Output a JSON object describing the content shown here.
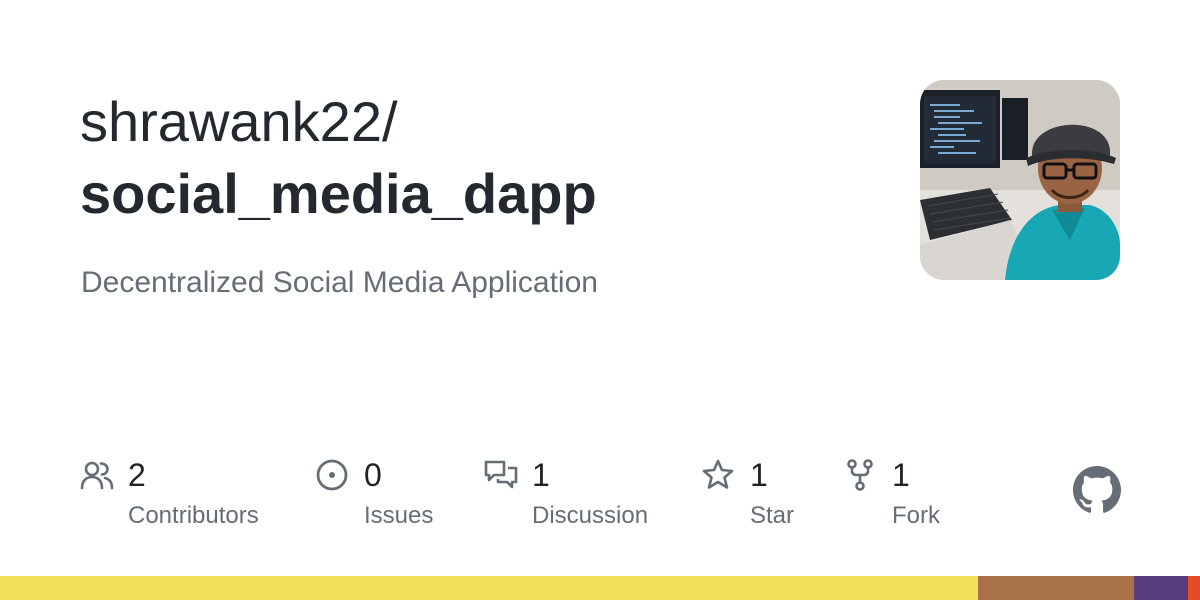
{
  "repo": {
    "owner": "shrawank22/",
    "name": "social_media_dapp",
    "description": "Decentralized Social Media Application"
  },
  "stats": [
    {
      "icon": "people-icon",
      "value": "2",
      "label": "Contributors"
    },
    {
      "icon": "issue-circle-icon",
      "value": "0",
      "label": "Issues"
    },
    {
      "icon": "discussion-icon",
      "value": "1",
      "label": "Discussion"
    },
    {
      "icon": "star-icon",
      "value": "1",
      "label": "Star"
    },
    {
      "icon": "fork-icon",
      "value": "1",
      "label": "Fork"
    }
  ],
  "logo": {
    "icon": "github-mark-icon"
  },
  "avatar": {
    "icon": "owner-avatar-photo"
  },
  "language_bar": [
    {
      "color": "#f1e05a",
      "share": 81.5
    },
    {
      "color": "#a97148",
      "share": 13.0
    },
    {
      "color": "#563d7c",
      "share": 4.5
    },
    {
      "color": "#e34c26",
      "share": 1.0
    }
  ],
  "colors": {
    "text_primary": "#24292f",
    "text_secondary": "#656d76",
    "icon_gray": "#656d76"
  }
}
